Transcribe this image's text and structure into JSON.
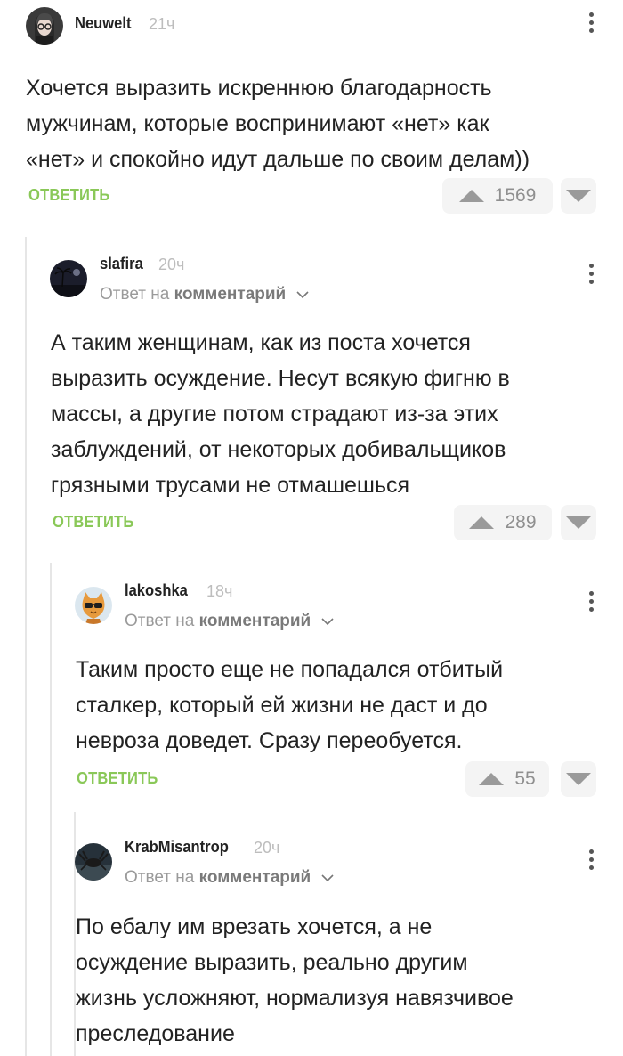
{
  "comments": [
    {
      "username": "Neuwelt",
      "time": "21ч",
      "reply_to": null,
      "text": "Хочется выразить искреннюю благодарность\nмужчинам, которые воспринимают «нет» как\n«нет» и спокойно идут дальше по своим делам))",
      "reply_label": "ОТВЕТИТЬ",
      "score": "1569"
    },
    {
      "username": "slafira",
      "time": "20ч",
      "reply_to": {
        "prefix": "Ответ на",
        "target": "комментарий"
      },
      "text": "А таким женщинам, как из поста хочется\nвыразить осуждение. Несут всякую фигню в\nмассы, а другие потом страдают из-за этих\nзаблуждений, от некоторых добивальщиков\nгрязными трусами не отмашешься",
      "reply_label": "ОТВЕТИТЬ",
      "score": "289"
    },
    {
      "username": "lakoshka",
      "time": "18ч",
      "reply_to": {
        "prefix": "Ответ на",
        "target": "комментарий"
      },
      "text": "Таким просто еще не попадался отбитый\nсталкер, который ей жизни не даст и до\nневроза доведет. Сразу переобуется.",
      "reply_label": "ОТВЕТИТЬ",
      "score": "55"
    },
    {
      "username": "KrabMisantrop",
      "time": "20ч",
      "reply_to": {
        "prefix": "Ответ на",
        "target": "комментарий"
      },
      "text": "По ебалу им врезать хочется, а не\nосуждение выразить, реально другим\nжизнь усложняют, нормализуя навязчивое\nпреследование",
      "reply_label": null,
      "score": null
    }
  ],
  "icons": {
    "upvote": "upvote-icon",
    "downvote": "downvote-icon",
    "more": "more-vertical-icon",
    "chevron": "chevron-down-icon"
  },
  "colors": {
    "reply_green": "#8ac858",
    "muted": "#9a9a9a",
    "vote_bg": "#f4f4f4"
  }
}
